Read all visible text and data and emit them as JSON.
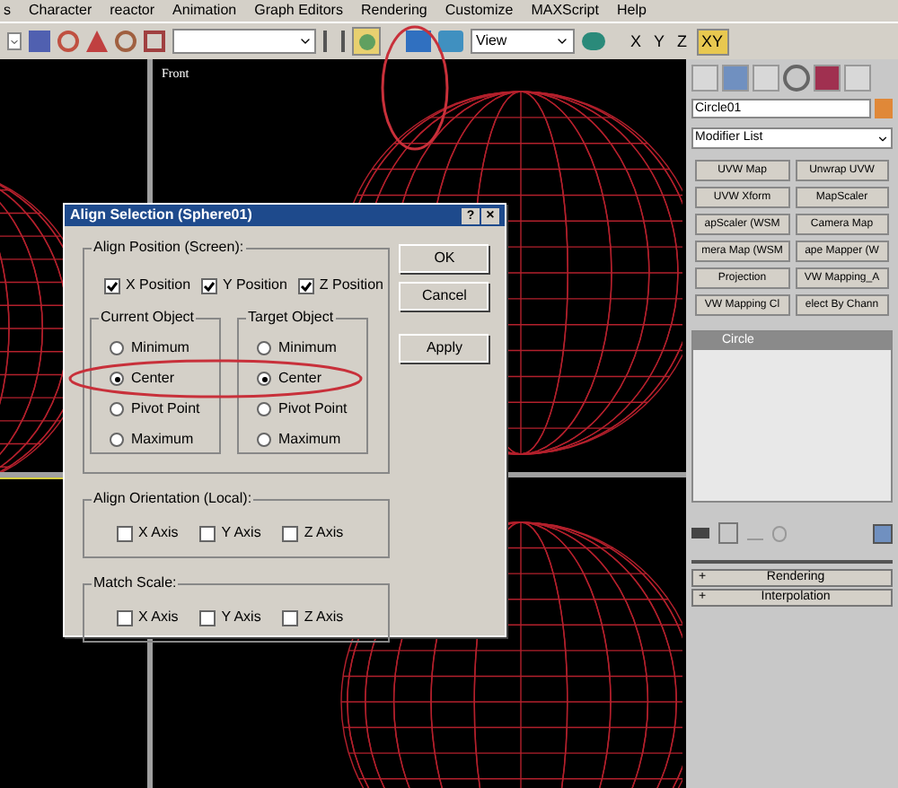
{
  "menu_bar": {
    "items": [
      "s",
      "Character",
      "reactor",
      "Animation",
      "Graph Editors",
      "Rendering",
      "Customize",
      "MAXScript",
      "Help"
    ]
  },
  "toolbar": {
    "view_dropdown": "View",
    "axis_buttons": [
      {
        "label": "X",
        "selected": false
      },
      {
        "label": "Y",
        "selected": false
      },
      {
        "label": "Z",
        "selected": false
      },
      {
        "label": "XY",
        "selected": true
      }
    ]
  },
  "viewport": {
    "label": "Front"
  },
  "dialog": {
    "title": "Align Selection (Sphere01)",
    "help_button": "?",
    "close_button": "×",
    "align_position": {
      "title": "Align Position (Screen):",
      "checks": [
        {
          "label": "X Position",
          "checked": true
        },
        {
          "label": "Y Position",
          "checked": true
        },
        {
          "label": "Z Position",
          "checked": true
        }
      ]
    },
    "current_object": {
      "title": "Current Object",
      "options": [
        {
          "label": "Minimum",
          "selected": false
        },
        {
          "label": "Center",
          "selected": true
        },
        {
          "label": "Pivot Point",
          "selected": false
        },
        {
          "label": "Maximum",
          "selected": false
        }
      ]
    },
    "target_object": {
      "title": "Target Object",
      "options": [
        {
          "label": "Minimum",
          "selected": false
        },
        {
          "label": "Center",
          "selected": true
        },
        {
          "label": "Pivot Point",
          "selected": false
        },
        {
          "label": "Maximum",
          "selected": false
        }
      ]
    },
    "align_orientation": {
      "title": "Align Orientation (Local):",
      "checks": [
        {
          "label": "X Axis",
          "checked": false
        },
        {
          "label": "Y Axis",
          "checked": false
        },
        {
          "label": "Z Axis",
          "checked": false
        }
      ]
    },
    "match_scale": {
      "title": "Match Scale:",
      "checks": [
        {
          "label": "X Axis",
          "checked": false
        },
        {
          "label": "Y Axis",
          "checked": false
        },
        {
          "label": "Z Axis",
          "checked": false
        }
      ]
    },
    "buttons": [
      "OK",
      "Cancel",
      "Apply"
    ]
  },
  "command_panel": {
    "object_name": "Circle01",
    "modifier_list": "Modifier List",
    "modifier_buttons": [
      "UVW Map",
      "Unwrap UVW",
      "UVW Xform",
      "MapScaler",
      "apScaler (WSM",
      "Camera Map",
      "mera Map (WSM",
      "ape Mapper (W",
      "Projection",
      "VW Mapping_A",
      "VW Mapping Cl",
      "elect By Chann"
    ],
    "stack": [
      {
        "label": "Circle",
        "selected": true
      }
    ],
    "rollouts": [
      {
        "sign": "+",
        "label": "Rendering"
      },
      {
        "sign": "+",
        "label": "Interpolation"
      }
    ]
  }
}
